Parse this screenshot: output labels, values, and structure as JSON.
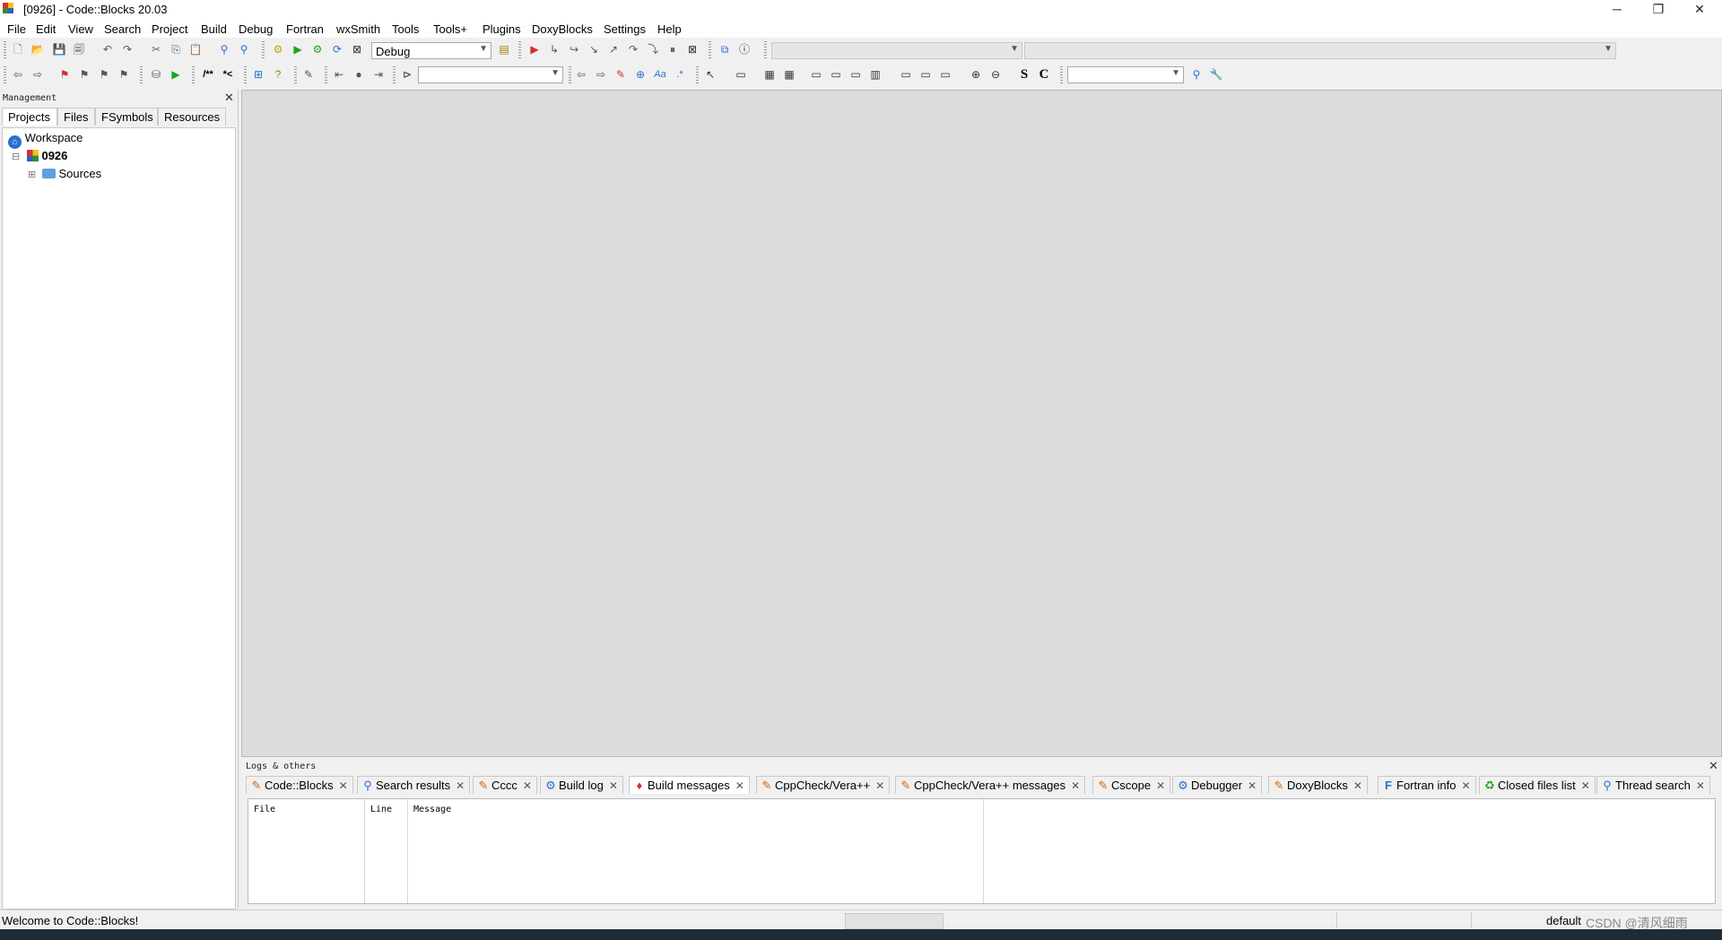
{
  "window": {
    "title": "[0926] - Code::Blocks 20.03",
    "minimize_glyph": "─",
    "restore_glyph": "❐",
    "close_glyph": "✕"
  },
  "menu": [
    "File",
    "Edit",
    "View",
    "Search",
    "Project",
    "Build",
    "Debug",
    "Fortran",
    "wxSmith",
    "Tools",
    "Tools+",
    "Plugins",
    "DoxyBlocks",
    "Settings",
    "Help"
  ],
  "toolbar": {
    "build_target": "Debug",
    "row1_icons": [
      "new-file",
      "open",
      "save",
      "save-all",
      "undo",
      "redo",
      "cut",
      "copy",
      "paste",
      "find",
      "replace",
      "build",
      "run",
      "build-and-run",
      "rebuild",
      "abort"
    ],
    "debug_icons": [
      "debug-run",
      "run-to-cursor",
      "next-line",
      "step-into",
      "step-out",
      "next-instruction",
      "step-into-instruction",
      "break",
      "stop-debugger",
      "debug-windows",
      "info"
    ],
    "row2_left_glyphs": [
      "⇦",
      "⇨",
      "⚑",
      "⚑",
      "⚑",
      "⚑",
      "⛁",
      "▶",
      "/**",
      "*<",
      "⊞",
      "?",
      "✎",
      "◁",
      "●",
      "▷",
      "▷"
    ],
    "row2_mid_glyphs": [
      "⇦",
      "⇨",
      "✎",
      "⊕",
      "Aa",
      ".*",
      "↖",
      "▭",
      "▦",
      "▦",
      "▭",
      "▭",
      "▭",
      "▭",
      "▭",
      "▭",
      "▭",
      "⊕",
      "⊖",
      "S",
      "C",
      "⚲",
      "🔧"
    ]
  },
  "management": {
    "caption": "Management",
    "close_glyph": "✕",
    "tabs": [
      "Projects",
      "Files",
      "FSymbols",
      "Resources"
    ],
    "active_tab": 0,
    "tree": {
      "workspace": "Workspace",
      "project": "0926",
      "sources": "Sources",
      "expand_minus": "⊟",
      "expand_plus": "⊞"
    }
  },
  "logs": {
    "caption": "Logs & others",
    "close_glyph": "✕",
    "tabs": [
      {
        "label": "Code::Blocks",
        "icon": "note-icon",
        "glyph": "✎"
      },
      {
        "label": "Search results",
        "icon": "search-icon",
        "glyph": "⚲"
      },
      {
        "label": "Cccc",
        "icon": "note-icon",
        "glyph": "✎"
      },
      {
        "label": "Build log",
        "icon": "gear-icon",
        "glyph": "⚙"
      },
      {
        "label": "Build messages",
        "icon": "pin-icon",
        "glyph": "♦"
      },
      {
        "label": "CppCheck/Vera++",
        "icon": "note-icon",
        "glyph": "✎"
      },
      {
        "label": "CppCheck/Vera++ messages",
        "icon": "note-icon",
        "glyph": "✎"
      },
      {
        "label": "Cscope",
        "icon": "note-icon",
        "glyph": "✎"
      },
      {
        "label": "Debugger",
        "icon": "gear-icon",
        "glyph": "⚙"
      },
      {
        "label": "DoxyBlocks",
        "icon": "note-icon",
        "glyph": "✎"
      },
      {
        "label": "Fortran info",
        "icon": "info-icon",
        "glyph": "F"
      },
      {
        "label": "Closed files list",
        "icon": "recycle-icon",
        "glyph": "♻"
      },
      {
        "label": "Thread search",
        "icon": "search-icon",
        "glyph": "⚲"
      }
    ],
    "tab_close_glyph": "✕",
    "active_tab": 4,
    "columns": [
      "File",
      "Line",
      "Message"
    ]
  },
  "status": {
    "message": "Welcome to Code::Blocks!",
    "right_label": "default",
    "watermark": "CSDN @清风细雨"
  },
  "colors": {
    "editor_bg": "#dcdcdc",
    "chrome_bg": "#f0f0f0",
    "run_green": "#1aa51a",
    "debug_red": "#d23030",
    "accent_blue": "#2a6fd1"
  }
}
